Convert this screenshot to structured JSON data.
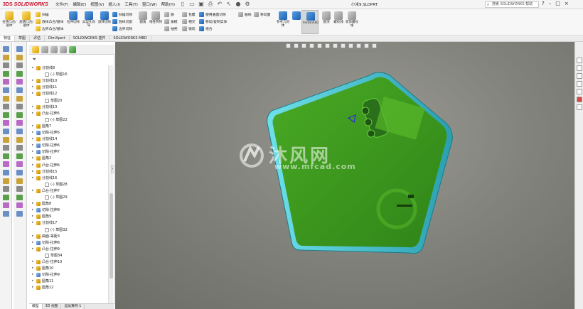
{
  "app": {
    "logo_ds": "3DS",
    "logo_brand": "SOLIDWORKS",
    "menus": [
      "文件(F)",
      "编辑(E)",
      "视图(V)",
      "插入(I)",
      "工具(T)",
      "窗口(W)",
      "帮助(H)"
    ],
    "document_title": "小米9.SLDPRT",
    "search_placeholder": "搜索 SOLIDWORKS 帮助",
    "quick_icons": [
      "new-icon",
      "open-icon",
      "save-icon",
      "print-icon",
      "undo-icon",
      "select-icon",
      "rebuild-icon",
      "options-icon"
    ]
  },
  "toolbar": {
    "extrude_boss": "拉伸凸台/基体",
    "revolve_boss": "旋转凸台/基体",
    "sweep": "扫描",
    "loft": "放样凸台/基体",
    "boundary_boss": "边界凸台/基体",
    "extrude_cut": "拉伸切除",
    "hole_wizard": "异型孔向导",
    "revolve_cut": "旋转切除",
    "swept_cut": "扫描切除",
    "lofted_cut": "放样切割",
    "boundary_cut": "边界切除",
    "fillet": "圆角",
    "linear_pattern": "线性阵列",
    "rib": "筋",
    "draft": "拔模",
    "shell": "抽壳",
    "wrap": "包覆",
    "intersect": "相交",
    "mirror": "镜向",
    "use_surfaces": "使用曲面切除",
    "move_copy": "移动/复制实体",
    "combine": "组合",
    "curves": "曲线",
    "move_face": "移动面",
    "ref_geometry": "参考几何体",
    "instant3d": "Instant3D",
    "wrap2": "圆顶",
    "reference": "螺纹线",
    "thread": "装饰螺纹线"
  },
  "tabs": [
    "特征",
    "草图",
    "评估",
    "DimXpert",
    "SOLIDWORKS 插件",
    "SOLIDWORKS MBD"
  ],
  "feature_tree": [
    {
      "label": "分割线8",
      "indent": 1,
      "kind": "feat"
    },
    {
      "label": "(-) 草图16",
      "indent": 2,
      "kind": "sketch"
    },
    {
      "label": "分割线10",
      "indent": 1,
      "kind": "feat"
    },
    {
      "label": "分割线11",
      "indent": 1,
      "kind": "feat"
    },
    {
      "label": "分割线12",
      "indent": 1,
      "kind": "feat"
    },
    {
      "label": "草图20",
      "indent": 2,
      "kind": "sketch"
    },
    {
      "label": "分割线13",
      "indent": 1,
      "kind": "feat"
    },
    {
      "label": "凸台-拉伸5",
      "indent": 1,
      "kind": "feat"
    },
    {
      "label": "(-) 草图22",
      "indent": 2,
      "kind": "sketch"
    },
    {
      "label": "圆角7",
      "indent": 1,
      "kind": "feat"
    },
    {
      "label": "切除-拉伸5",
      "indent": 1,
      "kind": "cut"
    },
    {
      "label": "分割线14",
      "indent": 1,
      "kind": "feat"
    },
    {
      "label": "切除-拉伸6",
      "indent": 1,
      "kind": "cut"
    },
    {
      "label": "切除-拉伸7",
      "indent": 1,
      "kind": "cut"
    },
    {
      "label": "圆角2",
      "indent": 1,
      "kind": "feat"
    },
    {
      "label": "凸台-拉伸6",
      "indent": 1,
      "kind": "feat"
    },
    {
      "label": "分割线15",
      "indent": 1,
      "kind": "feat"
    },
    {
      "label": "分割线16",
      "indent": 1,
      "kind": "feat"
    },
    {
      "label": "(-) 草图28",
      "indent": 2,
      "kind": "sketch"
    },
    {
      "label": "凸台-拉伸7",
      "indent": 1,
      "kind": "feat"
    },
    {
      "label": "(-) 草图29",
      "indent": 2,
      "kind": "sketch"
    },
    {
      "label": "圆角8",
      "indent": 1,
      "kind": "feat"
    },
    {
      "label": "切除-拉伸8",
      "indent": 1,
      "kind": "cut"
    },
    {
      "label": "圆角9",
      "indent": 1,
      "kind": "feat"
    },
    {
      "label": "分割线17",
      "indent": 1,
      "kind": "feat"
    },
    {
      "label": "(-) 草图32",
      "indent": 2,
      "kind": "sketch"
    },
    {
      "label": "曲面-等距3",
      "indent": 1,
      "kind": "feat"
    },
    {
      "label": "切除-拉伸8",
      "indent": 1,
      "kind": "cut"
    },
    {
      "label": "凸台-拉伸9",
      "indent": 1,
      "kind": "feat"
    },
    {
      "label": "草图34",
      "indent": 2,
      "kind": "sketch"
    },
    {
      "label": "凸台-拉伸10",
      "indent": 1,
      "kind": "feat"
    },
    {
      "label": "圆角10",
      "indent": 1,
      "kind": "feat"
    },
    {
      "label": "切除-拉伸9",
      "indent": 1,
      "kind": "cut"
    },
    {
      "label": "圆角11",
      "indent": 1,
      "kind": "feat"
    },
    {
      "label": "圆角12",
      "indent": 1,
      "kind": "feat"
    }
  ],
  "bottom_tabs": [
    "模型",
    "3D 视图",
    "运动算例 1"
  ],
  "watermark": {
    "cn": "沐风网",
    "url": "www.mfcad.com"
  },
  "colors": {
    "phone_body": "#3c9a1e",
    "phone_edge": "#4ec9d6",
    "viewport_bg": "#83837d",
    "brand_red": "#c8102e"
  }
}
